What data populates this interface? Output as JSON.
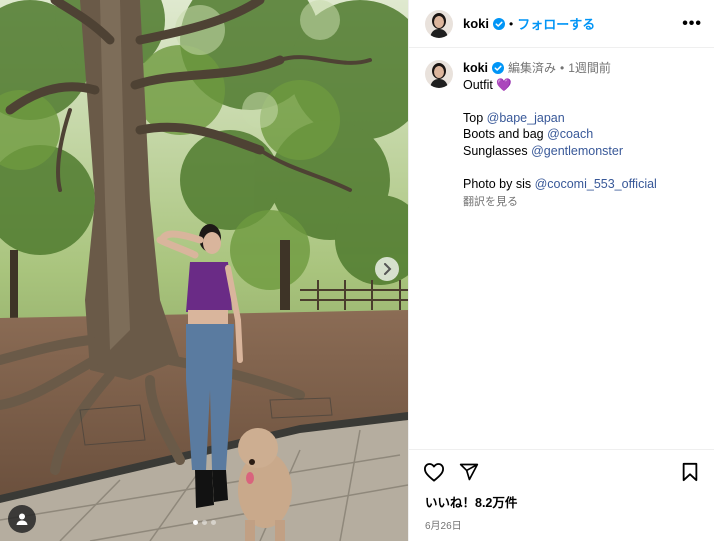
{
  "post": {
    "username": "koki",
    "header_separator": "•",
    "follow_label": "フォローする",
    "more_label": "•••"
  },
  "caption": {
    "username": "koki",
    "edited": "編集済み",
    "separator": "•",
    "time_ago": "1週間前",
    "line1_text": "Outfit",
    "line1_emoji": "💜",
    "line2_prefix": "Top",
    "line2_link": "@bape_japan",
    "line3_prefix": "Boots and bag",
    "line3_link": "@coach",
    "line4_prefix": "Sunglasses",
    "line4_link": "@gentlemonster",
    "line5_prefix": "Photo by sis",
    "line5_link": "@cocomi_553_official",
    "translate_label": "翻訳を見る"
  },
  "footer": {
    "likes": "いいね！8.2万件",
    "date": "6月26日"
  },
  "icons": {
    "verified": "verified-badge-icon",
    "more": "more-options-icon",
    "like": "heart-icon",
    "share": "share-icon",
    "save": "bookmark-icon",
    "next": "chevron-right-icon",
    "user_tag": "user-tag-icon"
  },
  "colors": {
    "follow_blue": "#0095f6",
    "link_blue": "#385898",
    "verified_blue": "#0095f6",
    "meta_gray": "#737373"
  },
  "carousel": {
    "total": 3,
    "current": 1
  }
}
